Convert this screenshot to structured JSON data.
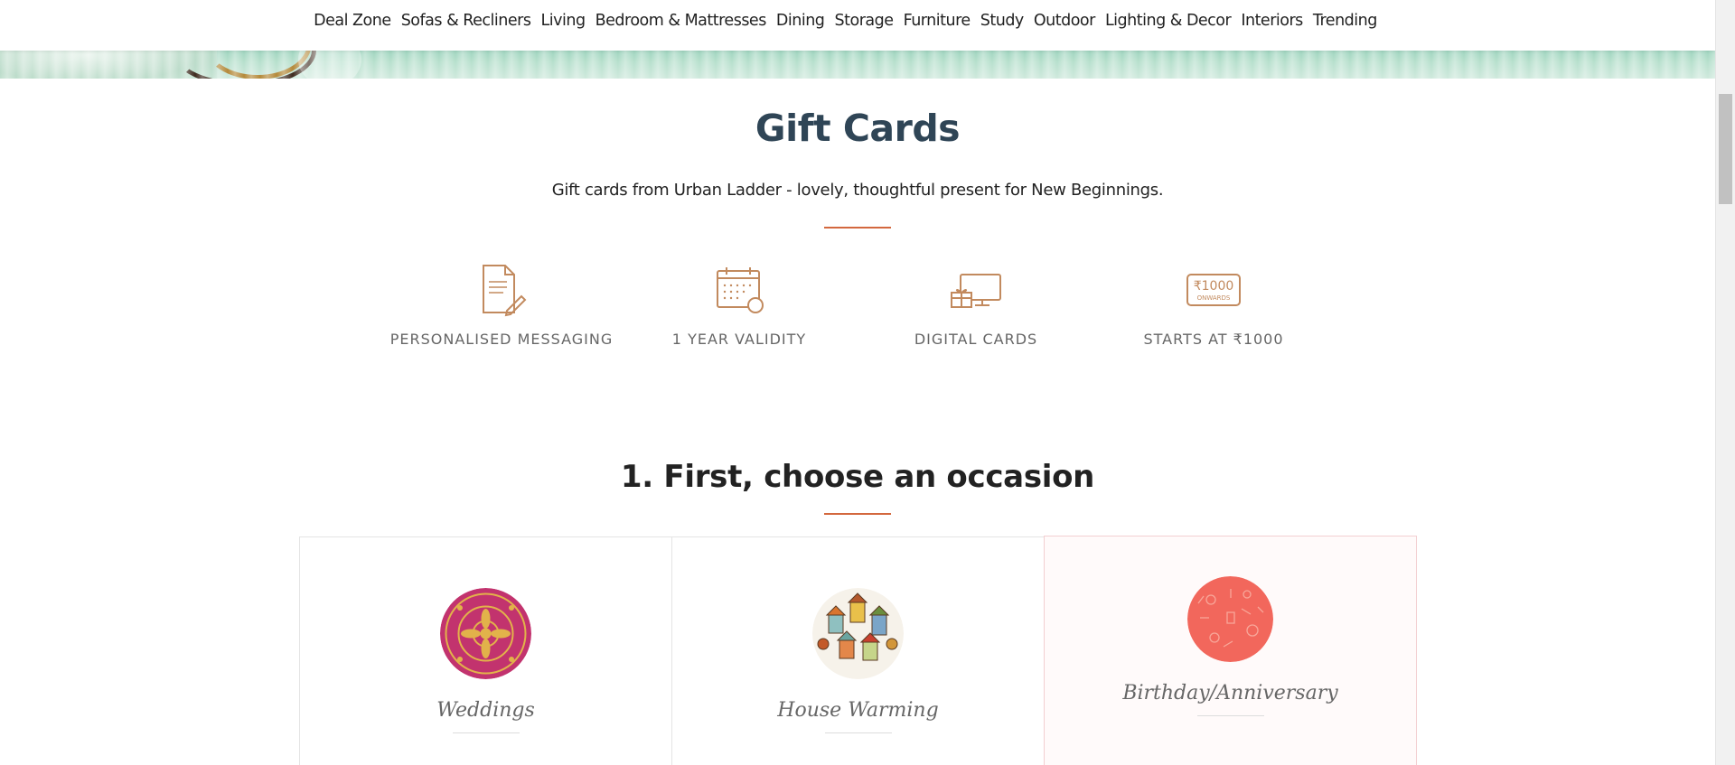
{
  "nav": {
    "items": [
      "Deal Zone",
      "Sofas & Recliners",
      "Living",
      "Bedroom & Mattresses",
      "Dining",
      "Storage",
      "Furniture",
      "Study",
      "Outdoor",
      "Lighting & Decor",
      "Interiors",
      "Trending"
    ]
  },
  "header": {
    "title": "Gift Cards",
    "subtitle": "Gift cards from Urban Ladder - lovely, thoughtful present for New Beginnings."
  },
  "features": [
    {
      "icon": "document-pen-icon",
      "label": "PERSONALISED MESSAGING"
    },
    {
      "icon": "calendar-clock-icon",
      "label": "1 YEAR VALIDITY"
    },
    {
      "icon": "gift-screen-icon",
      "label": "DIGITAL CARDS"
    },
    {
      "icon": "rupee-badge-icon",
      "label": "STARTS AT ₹1000",
      "badge_amount": "₹1000",
      "badge_sub": "ONWARDS"
    }
  ],
  "occasion": {
    "heading": "1. First, choose an occasion",
    "cards": [
      {
        "name": "Weddings",
        "selected": false
      },
      {
        "name": "House Warming",
        "selected": false
      },
      {
        "name": "Birthday/Anniversary",
        "selected": true
      }
    ]
  },
  "colors": {
    "accent": "#d3683e",
    "icon": "#c28a5e",
    "title": "#2f4556"
  }
}
